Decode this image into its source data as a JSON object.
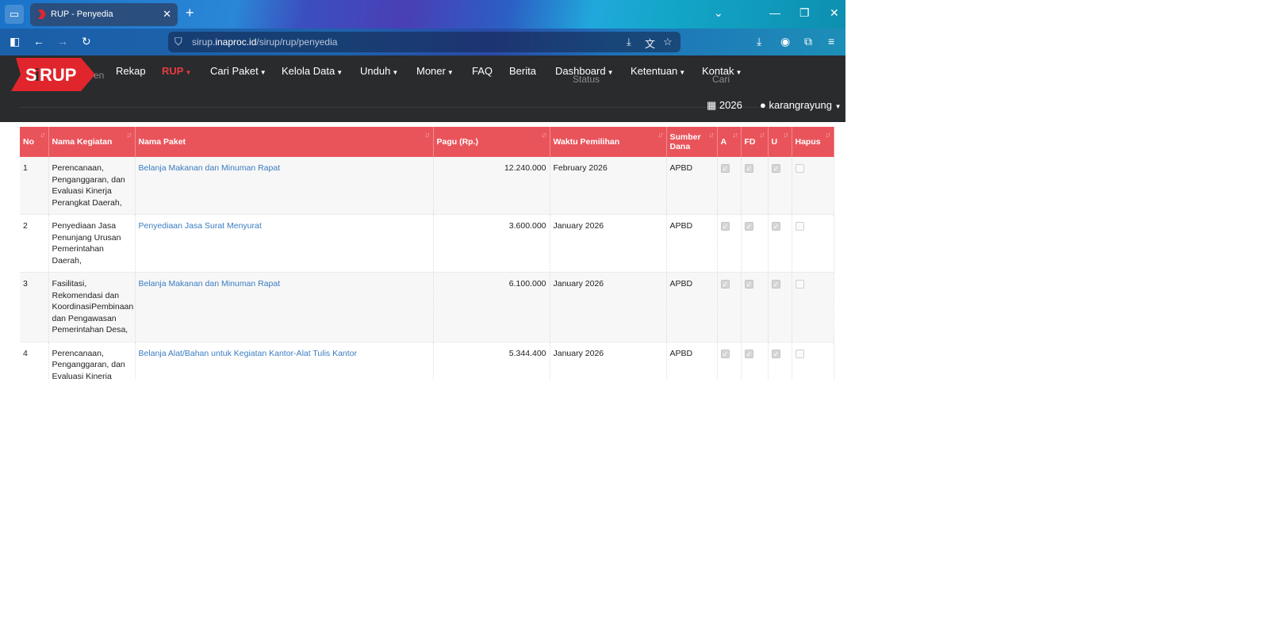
{
  "browser": {
    "tab_title": "RUP - Penyedia",
    "tab_close": "✕",
    "new_tab": "+",
    "url_domain": "sirup.inaproc.id",
    "url_path": "/sirup/rup/penyedia",
    "url_prefix": "sirup.",
    "url_host": "inaproc.id",
    "icons": [
      "sidebar-icon",
      "back-icon",
      "forward-icon",
      "reload-icon",
      "shield-icon",
      "install-icon",
      "translate-icon",
      "star-icon",
      "download-icon",
      "account-icon",
      "extensions-icon",
      "menu-icon"
    ]
  },
  "site": {
    "logo_text": "SiRUP",
    "menu": [
      {
        "label": "Rekap",
        "caret": false,
        "active": false
      },
      {
        "label": "RUP",
        "caret": true,
        "active": true
      },
      {
        "label": "Cari Paket",
        "caret": true,
        "active": false
      },
      {
        "label": "Kelola Data",
        "caret": true,
        "active": false
      },
      {
        "label": "Unduh",
        "caret": true,
        "active": false
      },
      {
        "label": "Moner",
        "caret": true,
        "active": false
      },
      {
        "label": "FAQ",
        "caret": false,
        "active": false
      },
      {
        "label": "Berita",
        "caret": false,
        "active": false
      },
      {
        "label": "Dashboard",
        "caret": true,
        "active": false
      },
      {
        "label": "Ketentuan",
        "caret": true,
        "active": false
      },
      {
        "label": "Kontak",
        "caret": true,
        "active": false
      }
    ],
    "year": "2026",
    "user": "karangrayung",
    "ghost_status": "Status",
    "ghost_cari": "Cari",
    "ghost_left": "en"
  },
  "table": {
    "headers": [
      "No",
      "Nama Kegiatan",
      "Nama Paket",
      "Pagu (Rp.)",
      "Waktu Pemilihan",
      "Sumber Dana",
      "A",
      "FD",
      "U",
      "Hapus"
    ],
    "rows": [
      {
        "no": "1",
        "kegiatan": "Perencanaan, Penganggaran, dan Evaluasi Kinerja Perangkat Daerah,",
        "paket": "Belanja Makanan dan Minuman Rapat",
        "pagu": "12.240.000",
        "waktu": "February 2026",
        "sumber": "APBD"
      },
      {
        "no": "2",
        "kegiatan": "Penyediaan Jasa Penunjang Urusan Pemerintahan Daerah,",
        "paket": "Penyediaan Jasa Surat Menyurat",
        "pagu": "3.600.000",
        "waktu": "January 2026",
        "sumber": "APBD"
      },
      {
        "no": "3",
        "kegiatan": "Fasilitasi, Rekomendasi dan KoordinasiPembinaan dan Pengawasan Pemerintahan Desa,",
        "paket": "Belanja Makanan dan Minuman Rapat",
        "pagu": "6.100.000",
        "waktu": "January 2026",
        "sumber": "APBD"
      },
      {
        "no": "4",
        "kegiatan": "Perencanaan, Penganggaran, dan Evaluasi Kinerja Perangkat Daerah,",
        "paket": "Belanja Alat/Bahan untuk Kegiatan Kantor-Alat Tulis Kantor",
        "pagu": "5.344.400",
        "waktu": "January 2026",
        "sumber": "APBD"
      }
    ]
  },
  "colors": {
    "header_red": "#e9545b",
    "active_menu": "#e83a3f",
    "link_blue": "#3a7cc2",
    "site_header_bg": "#2a2b2d"
  }
}
